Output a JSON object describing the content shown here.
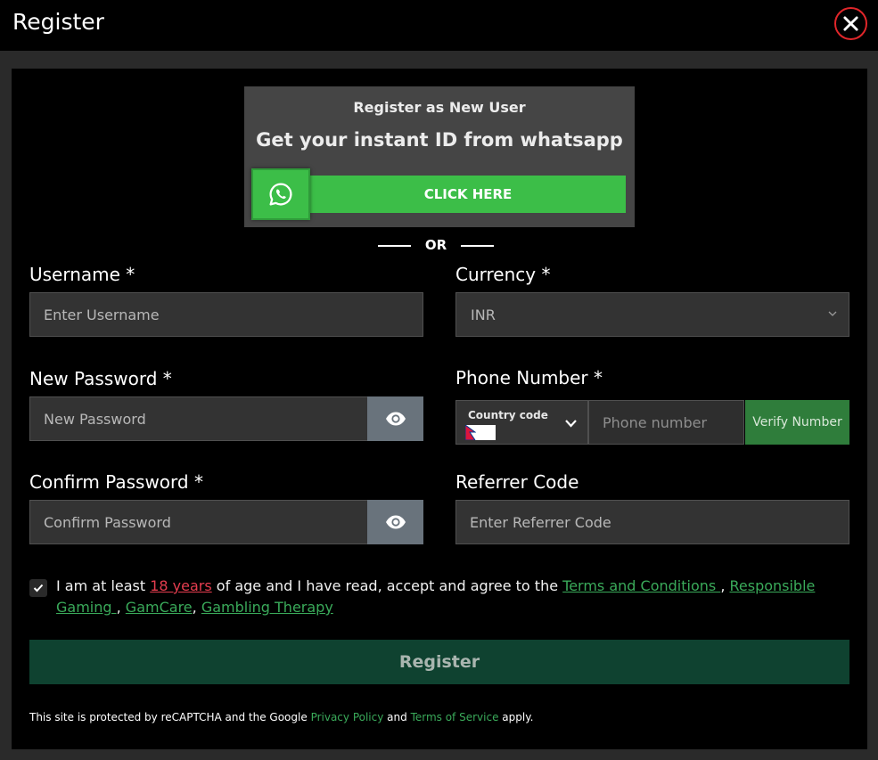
{
  "header": {
    "title": "Register"
  },
  "whatsapp": {
    "subtitle": "Register as New User",
    "heading": "Get your instant ID from whatsapp",
    "button_label": "CLICK HERE",
    "color": "#3cbe48"
  },
  "divider": {
    "text": "OR"
  },
  "form": {
    "username": {
      "label": "Username *",
      "placeholder": "Enter Username",
      "value": ""
    },
    "currency": {
      "label": "Currency *",
      "value": "INR"
    },
    "new_password": {
      "label": "New Password *",
      "placeholder": "New Password",
      "value": ""
    },
    "phone": {
      "label": "Phone Number *",
      "country_code_label": "Country code",
      "flag": "nepal-flag",
      "placeholder": "Phone number",
      "verify_label": "Verify Number"
    },
    "confirm_password": {
      "label": "Confirm Password *",
      "placeholder": "Confirm Password",
      "value": ""
    },
    "referrer": {
      "label": "Referrer Code",
      "placeholder": "Enter Referrer Code",
      "value": ""
    }
  },
  "terms": {
    "checked": true,
    "prefix": "I am at least ",
    "age_link": "18 years",
    "middle": " of age and I have read, accept and agree to the ",
    "terms_link": "Terms and Conditions ",
    "sep1": ", ",
    "responsible_link": "Responsible Gaming ",
    "sep2": ", ",
    "gamcare_link": "GamCare",
    "sep3": ", ",
    "therapy_link": "Gambling Therapy"
  },
  "register_button": {
    "label": "Register",
    "color": "#0f4230"
  },
  "recaptcha": {
    "prefix": "This site is protected by reCAPTCHA and the Google ",
    "privacy_link": "Privacy Policy",
    "and": " and ",
    "tos_link": "Terms of Service",
    "suffix": " apply."
  },
  "colors": {
    "accent_green": "#3aaa5a",
    "link_red": "#e53d4f",
    "close_red": "#e0262a"
  }
}
